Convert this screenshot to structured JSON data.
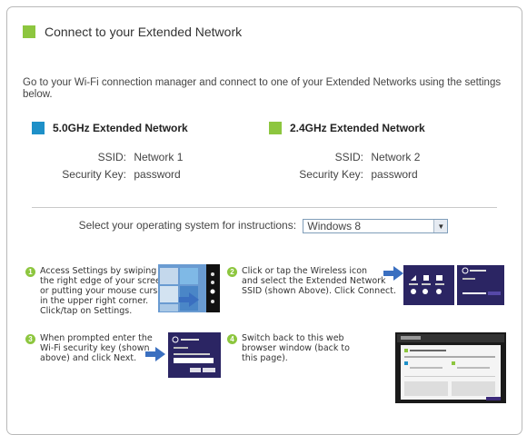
{
  "header": {
    "title": "Connect to your Extended Network"
  },
  "intro": "Go to your Wi-Fi connection manager and connect to one of your Extended Networks using the settings below.",
  "networks": [
    {
      "name": "5.0GHz Extended Network",
      "color": "#1e90c8",
      "ssid_label": "SSID:",
      "ssid": "Network 1",
      "key_label": "Security Key:",
      "key": "password"
    },
    {
      "name": "2.4GHz Extended Network",
      "color": "#8dc63f",
      "ssid_label": "SSID:",
      "ssid": "Network 2",
      "key_label": "Security Key:",
      "key": "password"
    }
  ],
  "os_select": {
    "label": "Select your operating system for instructions:",
    "value": "Windows 8"
  },
  "steps": [
    {
      "num": "1",
      "text": "Access Settings by swiping\nthe right edge of your screen\nor putting your mouse cursor\nin the upper right corner.\nClick/tap on Settings."
    },
    {
      "num": "2",
      "text": "Click or tap the Wireless icon\nand select the Extended Network\nSSID (shown Above). Click Connect."
    },
    {
      "num": "3",
      "text": "When prompted enter the\nWi-Fi security key (shown\nabove) and click Next."
    },
    {
      "num": "4",
      "text": "Switch back to this web\nbrowser window (back to\nthis page)."
    }
  ],
  "colors": {
    "accent_green": "#8dc63f",
    "accent_blue": "#1e90c8",
    "win8_purple": "#3c2a7a",
    "arrow_blue": "#3a6fc0"
  }
}
